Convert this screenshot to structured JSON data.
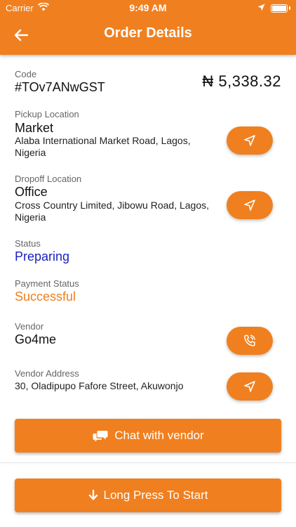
{
  "status_bar": {
    "carrier": "Carrier",
    "time": "9:49 AM"
  },
  "header": {
    "title": "Order Details"
  },
  "order": {
    "code_label": "Code",
    "code": "#TOv7ANwGST",
    "amount": "₦ 5,338.32",
    "pickup": {
      "label": "Pickup Location",
      "name": "Market",
      "address": "Alaba International Market Road, Lagos, Nigeria"
    },
    "dropoff": {
      "label": "Dropoff Location",
      "name": "Office",
      "address": "Cross Country Limited, Jibowu Road, Lagos, Nigeria"
    },
    "status": {
      "label": "Status",
      "value": "Preparing"
    },
    "payment": {
      "label": "Payment Status",
      "value": "Successful"
    },
    "vendor": {
      "label": "Vendor",
      "name": "Go4me"
    },
    "vendor_address": {
      "label": "Vendor Address",
      "address": "30, Oladipupo Fafore Street, Akuwonjo"
    }
  },
  "actions": {
    "chat_label": "Chat with vendor",
    "start_label": "Long Press To Start"
  },
  "colors": {
    "accent": "#F07F1F",
    "status_preparing": "#1a1fc0",
    "status_successful": "#F07F1F"
  },
  "icons": [
    "back-arrow-icon",
    "navigate-icon",
    "phone-icon",
    "chat-icon",
    "arrow-down-icon",
    "wifi-icon",
    "location-arrow-icon",
    "battery-icon"
  ]
}
